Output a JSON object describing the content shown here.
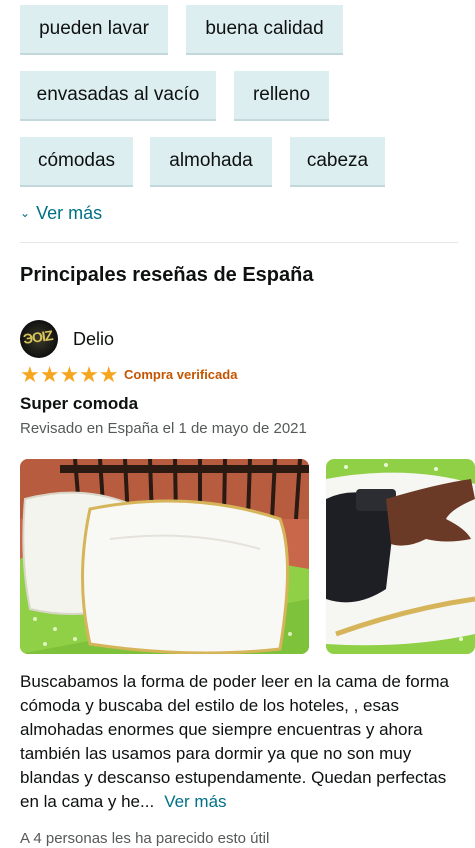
{
  "tags": [
    "pueden lavar",
    "buena calidad",
    "envasadas al vacío",
    "relleno",
    "cómodas",
    "almohada",
    "cabeza"
  ],
  "see_more_label": "Ver más",
  "section_title": "Principales reseñas de España",
  "review": {
    "reviewer_name": "Delio",
    "rating": 5,
    "stars": "★★★★★",
    "verified_label": "Compra verificada",
    "title": "Super comoda",
    "date": "Revisado en España el 1 de mayo de 2021",
    "body": "Buscabamos la forma de poder leer en la cama de forma cómoda y buscaba del estilo de los hoteles, , esas almohadas enormes que siempre encuentras y ahora también las usamos para dormir ya que no son muy blandas y descanso estupendamente. Quedan perfectas en la cama y he...",
    "read_more_label": "Ver más",
    "helpful_text": "A 4 personas les ha parecido esto útil"
  },
  "colors": {
    "chip_bg": "#ddeef1",
    "link": "#007185",
    "star": "#f6a51f",
    "verified": "#c45500"
  }
}
